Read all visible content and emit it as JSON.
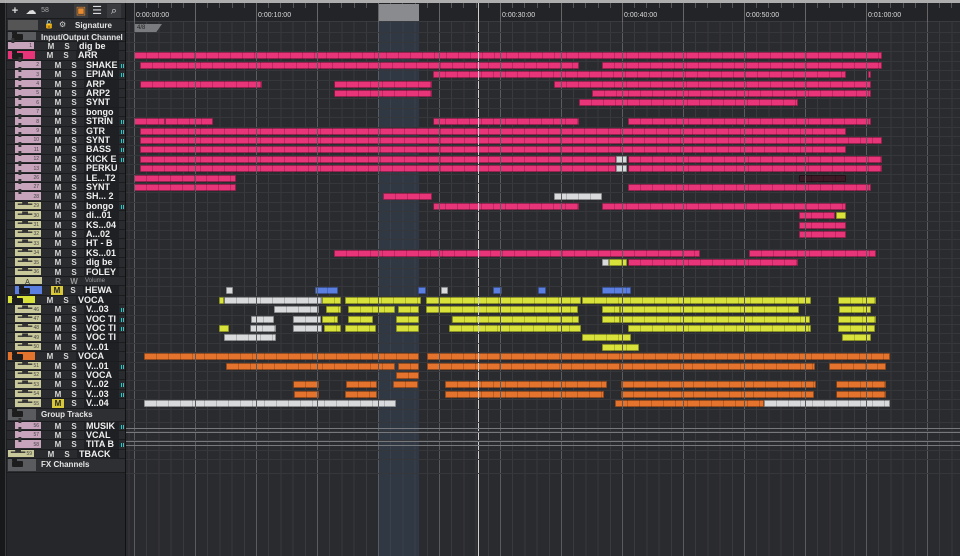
{
  "toolbar": {
    "add": "+",
    "instrument_count": "58",
    "icons": [
      "plus-icon",
      "instrument-cloud-icon",
      "track-view-icon",
      "list-icon",
      "search-icon"
    ]
  },
  "ruler": {
    "labels": [
      "0:00:00:00",
      "0:00:10:00",
      "0:00:20:00",
      "0:00:30:00",
      "0:00:40:00",
      "0:00:50:00",
      "0:01:00:00"
    ],
    "label_seconds": [
      0,
      10,
      20,
      30,
      40,
      50,
      60
    ]
  },
  "signature": "4/8",
  "playhead_seconds": 28.2,
  "cycle_seconds": [
    20.1,
    23.4
  ],
  "colors": {
    "pink": "#e8357a",
    "yellow": "#d8e23a",
    "orange": "#e4732e",
    "white": "#d9dadc",
    "blue": "#5b7fe0",
    "dark": "#3a1a24",
    "midi": "#c8a4bc",
    "audio": "#c9c89a",
    "grey": "#6a6b6e"
  },
  "tracks": [
    {
      "type": "sig",
      "label": "Signature"
    },
    {
      "type": "folderwide",
      "label": "Input/Output Channel"
    },
    {
      "type": "midi",
      "num": "1",
      "label": "dig be",
      "level": 0,
      "clips": []
    },
    {
      "type": "folder",
      "label": "ARR",
      "color": "pink",
      "clips": [
        [
          0,
          61.3,
          "pink"
        ]
      ]
    },
    {
      "type": "midi",
      "num": "2",
      "label": "SHAKE",
      "level": 1,
      "meter": true,
      "clips": [
        [
          0.5,
          36.5,
          "pink"
        ],
        [
          38.4,
          61.3,
          "pink"
        ]
      ]
    },
    {
      "type": "midi",
      "num": "3",
      "label": "EPIAN",
      "level": 1,
      "meter": true,
      "clips": [
        [
          24.5,
          58.4,
          "pink"
        ],
        [
          60.2,
          60.4,
          "pink"
        ]
      ]
    },
    {
      "type": "midi",
      "num": "4",
      "label": "ARP",
      "level": 1,
      "clips": [
        [
          0.5,
          10.5,
          "pink"
        ],
        [
          16.4,
          24.4,
          "pink"
        ],
        [
          34.4,
          60.4,
          "pink"
        ]
      ]
    },
    {
      "type": "midi",
      "num": "5",
      "label": "ARP2",
      "level": 1,
      "clips": [
        [
          16.4,
          24.4,
          "pink"
        ],
        [
          37.5,
          60.4,
          "pink"
        ]
      ]
    },
    {
      "type": "midi",
      "num": "6",
      "label": "SYNT",
      "level": 1,
      "clips": [
        [
          36.5,
          54.4,
          "pink"
        ]
      ]
    },
    {
      "type": "midi",
      "num": "7",
      "label": "bongo",
      "level": 1,
      "clips": []
    },
    {
      "type": "midi",
      "num": "8",
      "label": "STRIN",
      "level": 1,
      "meter": true,
      "clips": [
        [
          0,
          2.5,
          "pink"
        ],
        [
          2.5,
          6.5,
          "pink"
        ],
        [
          24.5,
          36.5,
          "pink"
        ],
        [
          40.5,
          60.4,
          "pink"
        ]
      ]
    },
    {
      "type": "midi",
      "num": "9",
      "label": "GTR",
      "level": 1,
      "meter": true,
      "clips": [
        [
          0.5,
          58.4,
          "pink"
        ]
      ]
    },
    {
      "type": "midi",
      "num": "10",
      "label": "SYNT",
      "level": 1,
      "meter": true,
      "clips": [
        [
          0.5,
          61.3,
          "pink"
        ]
      ]
    },
    {
      "type": "midi",
      "num": "11",
      "label": "BASS",
      "level": 1,
      "meter": true,
      "clips": [
        [
          0.5,
          58.4,
          "pink"
        ]
      ]
    },
    {
      "type": "midi",
      "num": "12",
      "label": "KICK E",
      "level": 1,
      "meter": true,
      "clips": [
        [
          0.5,
          39.5,
          "pink"
        ],
        [
          39.5,
          40.4,
          "white"
        ],
        [
          40.5,
          61.3,
          "pink"
        ]
      ]
    },
    {
      "type": "midi",
      "num": "13",
      "label": "PERKU",
      "level": 1,
      "clips": [
        [
          0.5,
          39.5,
          "pink"
        ],
        [
          39.5,
          40.4,
          "white"
        ],
        [
          40.5,
          61.3,
          "pink"
        ]
      ]
    },
    {
      "type": "midi",
      "num": "26",
      "label": "LE...T2",
      "level": 1,
      "clips": [
        [
          0,
          8.4,
          "pink"
        ],
        [
          54.5,
          58.4,
          "dark"
        ]
      ]
    },
    {
      "type": "midi",
      "num": "27",
      "label": "SYNT",
      "level": 1,
      "clips": [
        [
          0,
          8.4,
          "pink"
        ],
        [
          40.5,
          60.4,
          "pink"
        ]
      ]
    },
    {
      "type": "midi",
      "num": "28",
      "label": "SH... 2",
      "level": 1,
      "clips": [
        [
          20.4,
          24.4,
          "pink"
        ],
        [
          34.4,
          38.4,
          "white"
        ]
      ]
    },
    {
      "type": "audio",
      "num": "29",
      "label": "bongo",
      "level": 1,
      "meter": true,
      "clips": [
        [
          24.5,
          36.5,
          "pink"
        ],
        [
          38.4,
          58.4,
          "pink"
        ]
      ]
    },
    {
      "type": "audio",
      "num": "30",
      "label": "di...01",
      "level": 1,
      "clips": [
        [
          54.5,
          57.5,
          "pink"
        ],
        [
          57.5,
          58.4,
          "yellow"
        ]
      ]
    },
    {
      "type": "audio",
      "num": "31",
      "label": "KS...04",
      "level": 1,
      "clips": [
        [
          54.5,
          58.4,
          "pink"
        ]
      ]
    },
    {
      "type": "audio",
      "num": "32",
      "label": "A...02",
      "level": 1,
      "clips": [
        [
          54.5,
          58.4,
          "pink"
        ]
      ]
    },
    {
      "type": "audio",
      "num": "33",
      "label": "HT - B",
      "level": 1,
      "clips": []
    },
    {
      "type": "audio",
      "num": "34",
      "label": "KS...01",
      "level": 1,
      "clips": [
        [
          16.4,
          46.4,
          "pink"
        ],
        [
          50.4,
          60.8,
          "pink"
        ]
      ]
    },
    {
      "type": "audio",
      "num": "35",
      "label": "dig be",
      "level": 1,
      "clips": [
        [
          38.4,
          38.9,
          "white"
        ],
        [
          38.9,
          40.4,
          "yellow"
        ],
        [
          40.5,
          54.4,
          "pink"
        ]
      ]
    },
    {
      "type": "audio",
      "num": "36",
      "label": "FOLEY",
      "level": 1,
      "clips": []
    },
    {
      "type": "auto",
      "labels": [
        "A",
        "R",
        "W",
        "Volume"
      ]
    },
    {
      "type": "folder",
      "label": "HEWA",
      "color": "blue",
      "level": 1,
      "mute_on": true,
      "clips": [
        [
          7.5,
          8.1,
          "white"
        ],
        [
          14.8,
          16.7,
          "blue"
        ],
        [
          23.3,
          23.9,
          "blue"
        ],
        [
          25.2,
          25.7,
          "white"
        ],
        [
          29.4,
          30.2,
          "blue"
        ],
        [
          33.1,
          33.8,
          "blue"
        ],
        [
          38.4,
          40.7,
          "blue"
        ]
      ]
    },
    {
      "type": "folder",
      "label": "VOCA",
      "color": "yellow",
      "clips": [
        [
          7.0,
          7.4,
          "yellow"
        ],
        [
          7.4,
          15.4,
          "white"
        ],
        [
          15.4,
          17.0,
          "yellow"
        ],
        [
          17.3,
          23.5,
          "yellow"
        ],
        [
          23.9,
          36.6,
          "yellow"
        ],
        [
          36.7,
          55.5,
          "yellow"
        ],
        [
          57.7,
          60.8,
          "yellow"
        ]
      ]
    },
    {
      "type": "audio",
      "num": "46",
      "label": "V...03",
      "level": 1,
      "meter": true,
      "clips": [
        [
          11.5,
          15.2,
          "white"
        ],
        [
          15.7,
          17.0,
          "yellow"
        ],
        [
          17.5,
          21.4,
          "yellow"
        ],
        [
          21.6,
          23.4,
          "yellow"
        ],
        [
          23.9,
          36.4,
          "yellow"
        ],
        [
          38.4,
          39.8,
          "yellow"
        ],
        [
          39.8,
          54.5,
          "yellow"
        ],
        [
          57.8,
          60.4,
          "yellow"
        ]
      ]
    },
    {
      "type": "audio",
      "num": "47",
      "label": "VOC TI",
      "level": 1,
      "meter": true,
      "clips": [
        [
          9.6,
          11.5,
          "white"
        ],
        [
          13.0,
          15.3,
          "white"
        ],
        [
          15.4,
          16.7,
          "yellow"
        ],
        [
          17.5,
          19.6,
          "yellow"
        ],
        [
          21.5,
          23.4,
          "yellow"
        ],
        [
          26.1,
          36.5,
          "yellow"
        ],
        [
          38.4,
          39.8,
          "yellow"
        ],
        [
          39.8,
          55.4,
          "yellow"
        ],
        [
          57.7,
          60.8,
          "yellow"
        ]
      ]
    },
    {
      "type": "audio",
      "num": "48",
      "label": "VOC TI",
      "level": 1,
      "meter": true,
      "clips": [
        [
          7.0,
          7.8,
          "yellow"
        ],
        [
          9.5,
          11.6,
          "white"
        ],
        [
          13.0,
          15.4,
          "white"
        ],
        [
          15.6,
          17.0,
          "yellow"
        ],
        [
          17.3,
          19.8,
          "yellow"
        ],
        [
          21.5,
          23.4,
          "yellow"
        ],
        [
          25.8,
          36.6,
          "yellow"
        ],
        [
          40.5,
          55.5,
          "yellow"
        ],
        [
          57.7,
          60.7,
          "yellow"
        ]
      ]
    },
    {
      "type": "audio",
      "num": "49",
      "label": "VOC TI",
      "level": 1,
      "clips": [
        [
          7.4,
          11.6,
          "white"
        ],
        [
          36.7,
          40.7,
          "yellow"
        ],
        [
          58.0,
          60.4,
          "yellow"
        ]
      ]
    },
    {
      "type": "audio",
      "num": "50",
      "label": "V...01",
      "level": 1,
      "clips": [
        [
          38.4,
          41.4,
          "yellow"
        ]
      ]
    },
    {
      "type": "folder",
      "label": "VOCA",
      "color": "orange",
      "clips": [
        [
          0.8,
          23.4,
          "orange"
        ],
        [
          24.0,
          62.0,
          "orange"
        ]
      ]
    },
    {
      "type": "audio",
      "num": "51",
      "label": "V...01",
      "level": 1,
      "meter": true,
      "clips": [
        [
          7.5,
          21.4,
          "orange"
        ],
        [
          21.6,
          23.4,
          "orange"
        ],
        [
          24.0,
          39.8,
          "orange"
        ],
        [
          39.8,
          55.8,
          "orange"
        ],
        [
          57.0,
          61.6,
          "orange"
        ]
      ]
    },
    {
      "type": "audio",
      "num": "52",
      "label": "VOCA",
      "level": 1,
      "clips": [
        [
          21.5,
          23.4,
          "orange"
        ]
      ]
    },
    {
      "type": "audio",
      "num": "53",
      "label": "V...02",
      "level": 1,
      "meter": true,
      "clips": [
        [
          13.0,
          15.2,
          "orange"
        ],
        [
          17.4,
          19.9,
          "orange"
        ],
        [
          21.2,
          23.3,
          "orange"
        ],
        [
          25.5,
          38.8,
          "orange"
        ],
        [
          39.9,
          55.9,
          "orange"
        ],
        [
          57.5,
          61.6,
          "orange"
        ]
      ]
    },
    {
      "type": "audio",
      "num": "54",
      "label": "V...03",
      "level": 1,
      "meter": true,
      "clips": [
        [
          13.1,
          15.2,
          "orange"
        ],
        [
          17.3,
          19.9,
          "orange"
        ],
        [
          25.5,
          38.5,
          "orange"
        ],
        [
          39.9,
          55.7,
          "orange"
        ],
        [
          57.5,
          61.6,
          "orange"
        ]
      ]
    },
    {
      "type": "audio",
      "num": "55",
      "label": "V...04",
      "level": 1,
      "mute_on": true,
      "clips": [
        [
          0.8,
          21.5,
          "white"
        ],
        [
          39.4,
          51.6,
          "orange"
        ],
        [
          51.6,
          62.0,
          "white"
        ]
      ]
    },
    {
      "type": "folderwide",
      "label": "Group Tracks"
    },
    {
      "type": "group",
      "num": "56",
      "label": "MUSIK",
      "level": 1,
      "meter": true,
      "clips": []
    },
    {
      "type": "group",
      "num": "57",
      "label": "VCAL",
      "level": 1,
      "clips": []
    },
    {
      "type": "group",
      "num": "58",
      "label": "TITA B",
      "level": 1,
      "meter": true,
      "clips": []
    },
    {
      "type": "audio",
      "num": "59",
      "label": "TBACK",
      "level": 0,
      "clips": []
    },
    {
      "type": "folderwide",
      "label": "FX Channels"
    }
  ],
  "track_controls": {
    "mute": "M",
    "solo": "S"
  }
}
